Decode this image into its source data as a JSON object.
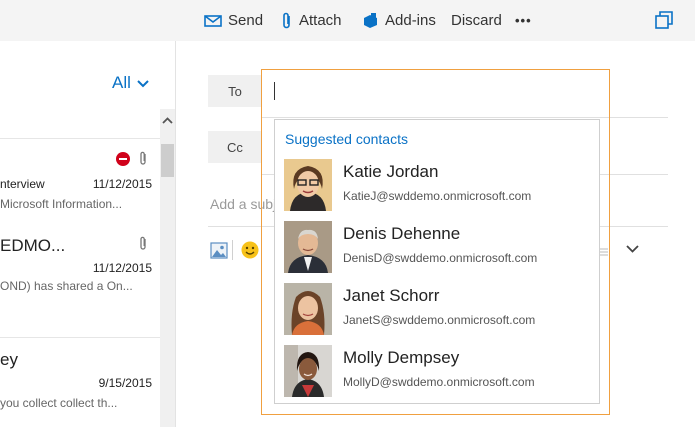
{
  "toolbar": {
    "send": "Send",
    "attach": "Attach",
    "addins": "Add-ins",
    "discard": "Discard",
    "more": "•••"
  },
  "list": {
    "filter": "All",
    "messages": [
      {
        "sender": "",
        "subject": "nterview",
        "date": "11/12/2015",
        "preview": "Microsoft Information..."
      },
      {
        "sender": "EDMO...",
        "subject": "",
        "date": "11/12/2015",
        "preview": "OND) has shared a On..."
      },
      {
        "sender": "ey",
        "subject": "",
        "date": "9/15/2015",
        "preview": "you collect collect th..."
      }
    ]
  },
  "compose": {
    "to_label": "To",
    "cc_label": "Cc",
    "subject_placeholder": "Add a subj"
  },
  "suggestions": {
    "title": "Suggested contacts",
    "contacts": [
      {
        "name": "Katie Jordan",
        "email": "KatieJ@swddemo.onmicrosoft.com"
      },
      {
        "name": "Denis Dehenne",
        "email": "DenisD@swddemo.onmicrosoft.com"
      },
      {
        "name": "Janet Schorr",
        "email": "JanetS@swddemo.onmicrosoft.com"
      },
      {
        "name": "Molly Dempsey",
        "email": "MollyD@swddemo.onmicrosoft.com"
      }
    ]
  },
  "colors": {
    "accent": "#0a72c6",
    "focus_border": "#f0a040",
    "flag_red": "#d0021b"
  },
  "icons": [
    "send-icon",
    "attach-icon",
    "addins-icon",
    "more-icon",
    "popout-icon",
    "chevron-down-icon",
    "scroll-up-icon",
    "blocked-icon",
    "paperclip-icon",
    "image-icon",
    "emoji-icon",
    "format-icon"
  ]
}
